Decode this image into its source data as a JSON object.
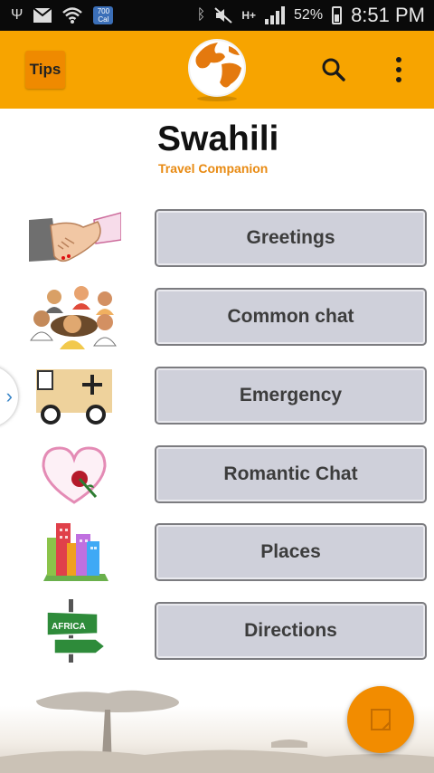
{
  "status_bar": {
    "calendar_badge": "700",
    "calendar_badge_sub": "Cal",
    "network": "H+",
    "battery": "52%",
    "time": "8:51 PM"
  },
  "app_bar": {
    "tips_label": "Tips",
    "logo_icon": "globe-icon",
    "search_icon": "search-icon",
    "menu_icon": "overflow-menu-icon",
    "background": "#f7a400"
  },
  "header": {
    "title": "Swahili",
    "subtitle": "Travel Companion"
  },
  "categories": [
    {
      "label": "Greetings",
      "icon": "handshake-icon"
    },
    {
      "label": "Common chat",
      "icon": "people-chat-icon"
    },
    {
      "label": "Emergency",
      "icon": "ambulance-icon"
    },
    {
      "label": "Romantic Chat",
      "icon": "heart-rose-icon"
    },
    {
      "label": "Places",
      "icon": "buildings-icon"
    },
    {
      "label": "Directions",
      "icon": "signpost-icon"
    }
  ],
  "signpost_text": "AFRICA",
  "side_tab_icon": "chevron-right-icon",
  "fab_icon": "notes-icon",
  "accent": "#f28c00"
}
